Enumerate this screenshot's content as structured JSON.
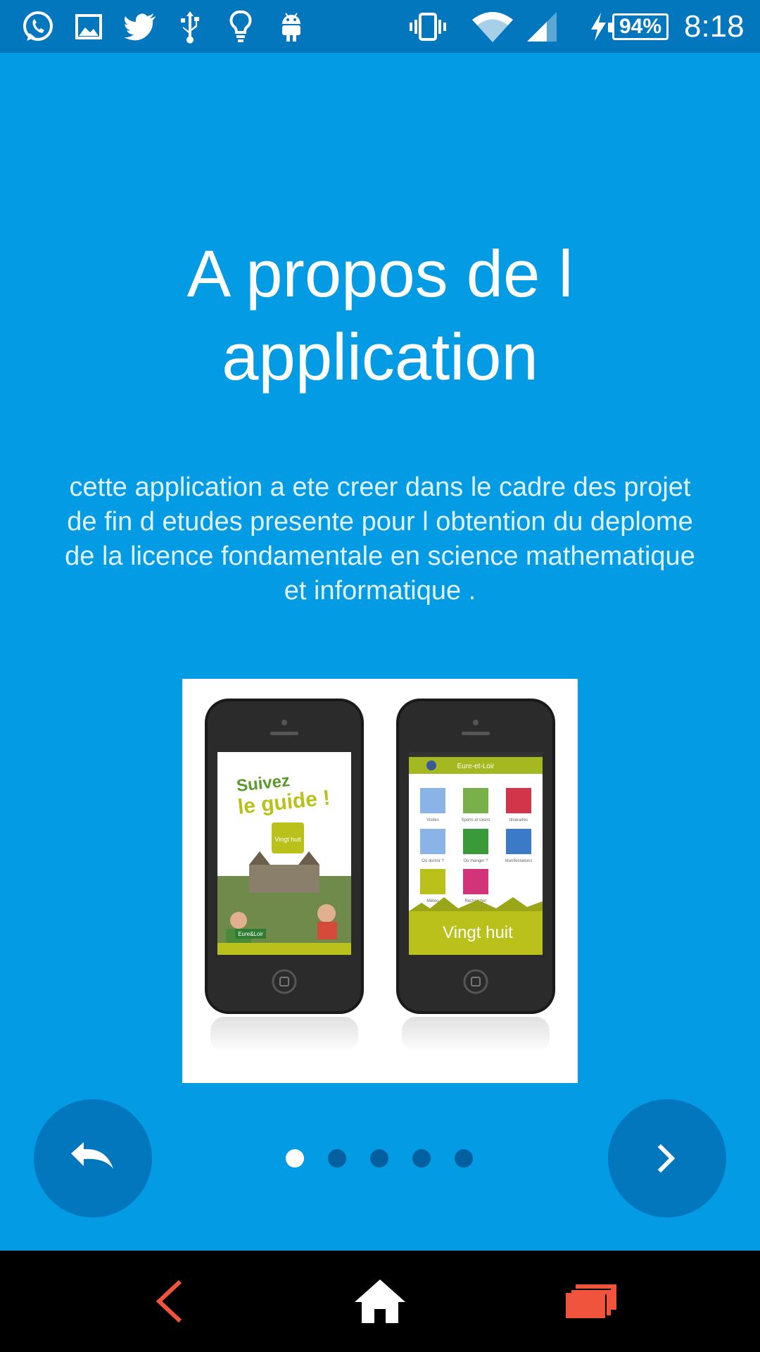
{
  "status_bar": {
    "notification_icons": [
      "whatsapp-icon",
      "gallery-icon",
      "twitter-icon",
      "usb-icon",
      "lightbulb-icon",
      "android-icon"
    ],
    "system_icons": [
      "vibrate-icon",
      "wifi-icon",
      "signal-icon",
      "charging-icon"
    ],
    "battery": "94%",
    "time": "8:18"
  },
  "intro": {
    "title_line1": "A propos de l",
    "title_line2": "application",
    "description": "cette application a ete creer dans le cadre des projet de fin d etudes presente pour l obtention du deplome de la licence fondamentale en science mathematique et informatique .",
    "image": {
      "left_phone": {
        "headline_1": "Suivez",
        "headline_2": "le guide !",
        "badge": "Vingt huit",
        "logo": "Eure&Loir"
      },
      "right_phone": {
        "header": "Eure-et-Loir",
        "tiles": [
          "Visites",
          "Sports et loisirs",
          "Itinéraires",
          "Où dormir ?",
          "Où manger ?",
          "Manifestations",
          "Météo",
          "Rechercher"
        ],
        "footer": "Vingt huit"
      }
    }
  },
  "pager": {
    "page_count": 5,
    "current_page": 1
  },
  "controls": {
    "back_icon": "undo-icon",
    "next_icon": "chevron-right-icon"
  },
  "nav_bar": {
    "back_icon": "nav-back-icon",
    "home_icon": "home-icon",
    "recents_icon": "recents-icon"
  },
  "colors": {
    "background": "#049be5",
    "status_bar": "#0277bd",
    "button": "#0277bd",
    "dot_inactive": "#0260a0",
    "dot_active": "#ffffff",
    "nav_back": "#f0543c",
    "nav_recents": "#f0543c"
  }
}
